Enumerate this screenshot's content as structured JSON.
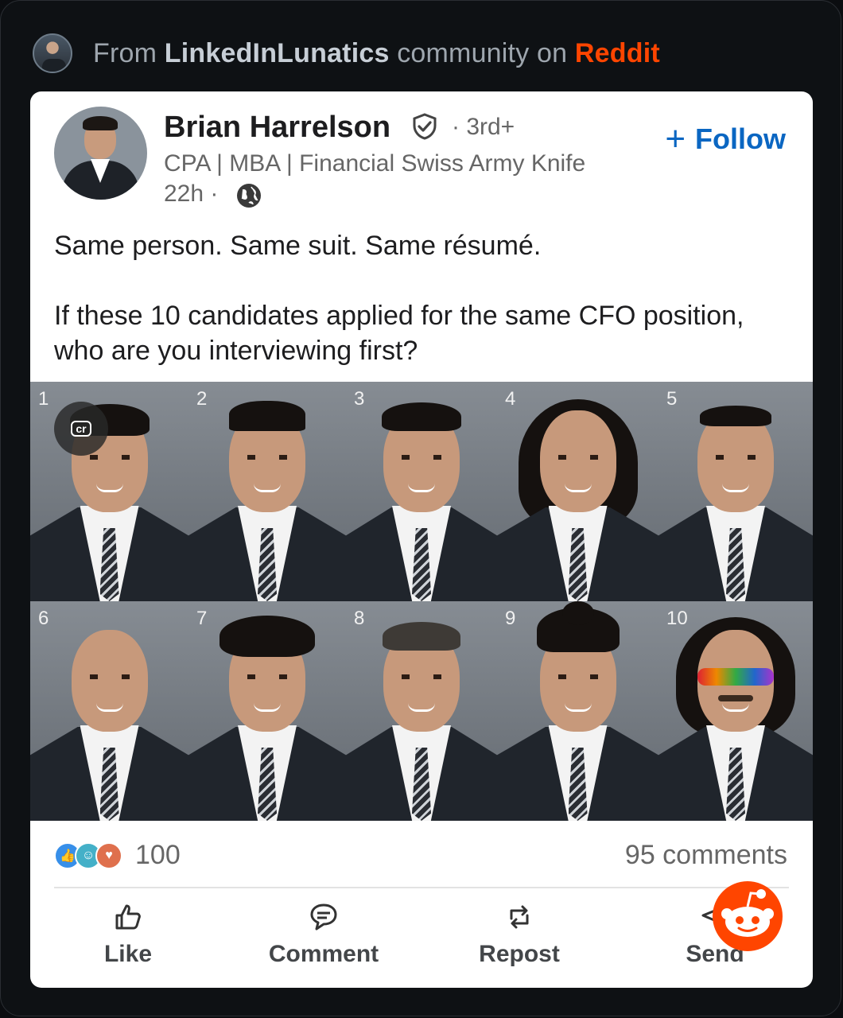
{
  "source_header": {
    "prefix": "From ",
    "community": "LinkedInLunatics",
    "middle": " community on ",
    "platform": "Reddit"
  },
  "post": {
    "author_name": "Brian Harrelson",
    "connection_degree": "· 3rd+",
    "author_headline": "CPA | MBA | Financial Swiss Army Knife",
    "time_ago": "22h ·",
    "follow_label": "Follow",
    "text_line_1": "Same person. Same suit. Same résumé.",
    "text_line_2": "If these 10 candidates applied for the same CFO position, who are you interviewing first?",
    "image_badge": "cr",
    "candidates": [
      "1",
      "2",
      "3",
      "4",
      "5",
      "6",
      "7",
      "8",
      "9",
      "10"
    ]
  },
  "social": {
    "reaction_count": "100",
    "comments": "95 comments",
    "reaction_icons": [
      "like-icon",
      "funny-icon",
      "love-icon"
    ]
  },
  "actions": {
    "like": "Like",
    "comment": "Comment",
    "repost": "Repost",
    "send": "Send"
  },
  "colors": {
    "linkedin_blue": "#0a66c2",
    "reddit_orange": "#ff4500",
    "background": "#0e1114"
  }
}
